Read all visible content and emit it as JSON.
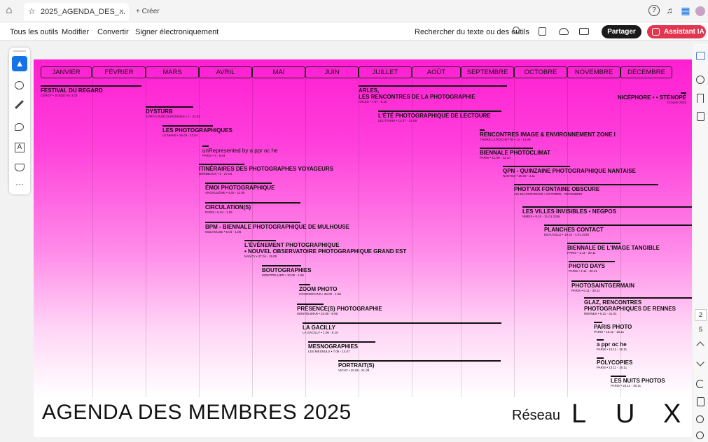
{
  "browser": {
    "tab_title": "2025_AGENDA_DES_...",
    "close": "×",
    "new_tab": "+ Créer"
  },
  "toolbar": {
    "all_tools": "Tous les outils",
    "edit": "Modifier",
    "convert": "Convertir",
    "sign": "Signer électroniquement",
    "search": "Rechercher du texte ou des outils",
    "share": "Partager",
    "assistant": "Assistant IA"
  },
  "colors": {
    "accent": "#ff1fd2",
    "share_bg": "#1a1a1a",
    "assistant_bg": "#e0364f",
    "select_blue": "#1473e6"
  },
  "icons": {
    "home": "⌂",
    "star": "☆",
    "help": "?",
    "bell": "♫",
    "apps": "▦"
  },
  "side_pages": {
    "current": "2",
    "total": "5"
  },
  "doc": {
    "months": [
      "JANVIER",
      "FÉVRIER",
      "MARS",
      "AVRIL",
      "MAI",
      "JUIN",
      "JUILLET",
      "AOÛT",
      "SEPTEMBRE",
      "OCTOBRE",
      "NOVEMBRE",
      "DÉCEMBRE"
    ],
    "title": "AGENDA DES MEMBRES 2025",
    "logo_prefix": "Réseau",
    "logo_letters": [
      "L",
      "U",
      "X"
    ],
    "events": [
      {
        "name": "FESTIVAL DU REGARD",
        "sub": "CERGY • JUSQU'AU 3.03"
      },
      {
        "name": "DYSTURB",
        "sub": "EVRY-COURCOURONNES • 1 - 31.03"
      },
      {
        "name": "LES PHOTOGRAPHIQUES",
        "sub": "LE MANS • 15.03 - 13.04"
      },
      {
        "name": "unRepresented by a ppr oc he",
        "sub": "PARIS • 4 - 6.04"
      },
      {
        "name": "ITINÉRAIRES DES PHOTOGRAPHES VOYAGEURS",
        "sub": "BORDEAUX • 2 - 27.04"
      },
      {
        "name": "ÉMOI PHOTOGRAPHIQUE",
        "sub": "ANGOULÊME • 4.04 - 11.05"
      },
      {
        "name": "CIRCULATION(S)",
        "sub": "PARIS • 5.04 - 1.06"
      },
      {
        "name": "BPM - BIENNALE PHOTOGRAPHIQUE DE MULHOUSE",
        "sub": "MULHOUSE • 5.04 - 1.06"
      },
      {
        "name": "L'ÉVÉNEMENT PHOTOGRAPHIQUE",
        "name2": "• NOUVEL OBSERVATOIRE PHOTOGRAPHIQUE GRAND EST",
        "sub": "NANCY • 27.04 - 15.05"
      },
      {
        "name": "BOUTOGRAPHIES",
        "sub": "MONTPELLIER • 10.05 - 1.06"
      },
      {
        "name": "ZOOM PHOTO",
        "sub": "COURSERANS • 26.05 - 1.06"
      },
      {
        "name": "PRÉSENCE(S) PHOTOGRAPHIE",
        "sub": "MONTÉLIMAR • 24.05 - 8.06"
      },
      {
        "name": "LA GACILLY",
        "sub": "LA GACILLY • 1.06 - 5.10"
      },
      {
        "name": "MESNOGRAPHIES",
        "sub": "LES MESNULS • 7.06 - 14.07"
      },
      {
        "name": "PORTRAIT(S)",
        "sub": "VICHY • 20.06 - 21.09"
      },
      {
        "name": "ARLES,",
        "name2": "LES RENCONTRES DE LA PHOTOGRAPHIE",
        "sub": "ARLES • 7.07 - 5.10"
      },
      {
        "name": "L'ÉTÉ PHOTOGRAPHIQUE DE LECTOURE",
        "sub": "LECTOURE • 12.07 - 21.09"
      },
      {
        "name": "NICÉPHORE • • STÉNOPÉ",
        "sub": "Octobre 2025"
      },
      {
        "name": "RENCONTRES IMAGE & ENVIRONNEMENT ZONE I",
        "sub": "THORÉ LA ROCHETTE • 12 - 14.09"
      },
      {
        "name": "BIENNALE PHOTOCLIMAT",
        "sub": "PARIS • 12.09 - 12.10"
      },
      {
        "name": "QPN - QUINZAINE PHOTOGRAPHIQUE NANTAISE",
        "sub": "NANTES • 26.09 - 2.11"
      },
      {
        "name": "PHOT'AIX FONTAINE OBSCURE",
        "sub": "AIX-EN-PROVENCE • OCTOBRE - DÉCEMBRE"
      },
      {
        "name": "LES VILLES INVISIBLES • NEGPOS",
        "sub": "NÎMES • 9.10 - 31.01.2026"
      },
      {
        "name": "PLANCHES CONTACT",
        "sub": "DEAUVILLE • 18.10 - 4.01.2026"
      },
      {
        "name": "BIENNALE DE L'IMAGE TANGIBLE",
        "sub": "PARIS • 1.11 - 30.11"
      },
      {
        "name": "PHOTO DAYS",
        "sub": "PARIS • 2.11 - 30.11"
      },
      {
        "name": "PHOTOSAINTGERMAIN",
        "sub": "PARIS • 6.11 - 30.11"
      },
      {
        "name": "GLAZ, RENCONTRES",
        "name2": "PHOTOGRAPHIQUES DE RENNES",
        "sub": "RENNES • 6.11 - 31.01"
      },
      {
        "name": "PARIS PHOTO",
        "sub": "PARIS • 12.11 - 16.11"
      },
      {
        "name": "a ppr oc he",
        "sub": "PARIS • 13.11 - 16.11"
      },
      {
        "name": "POLYCOPIES",
        "sub": "PARIS • 13.11 - 16.11"
      },
      {
        "name": "LES NUITS PHOTOS",
        "sub": "PARIS • 23.11 - 30.11"
      }
    ]
  }
}
